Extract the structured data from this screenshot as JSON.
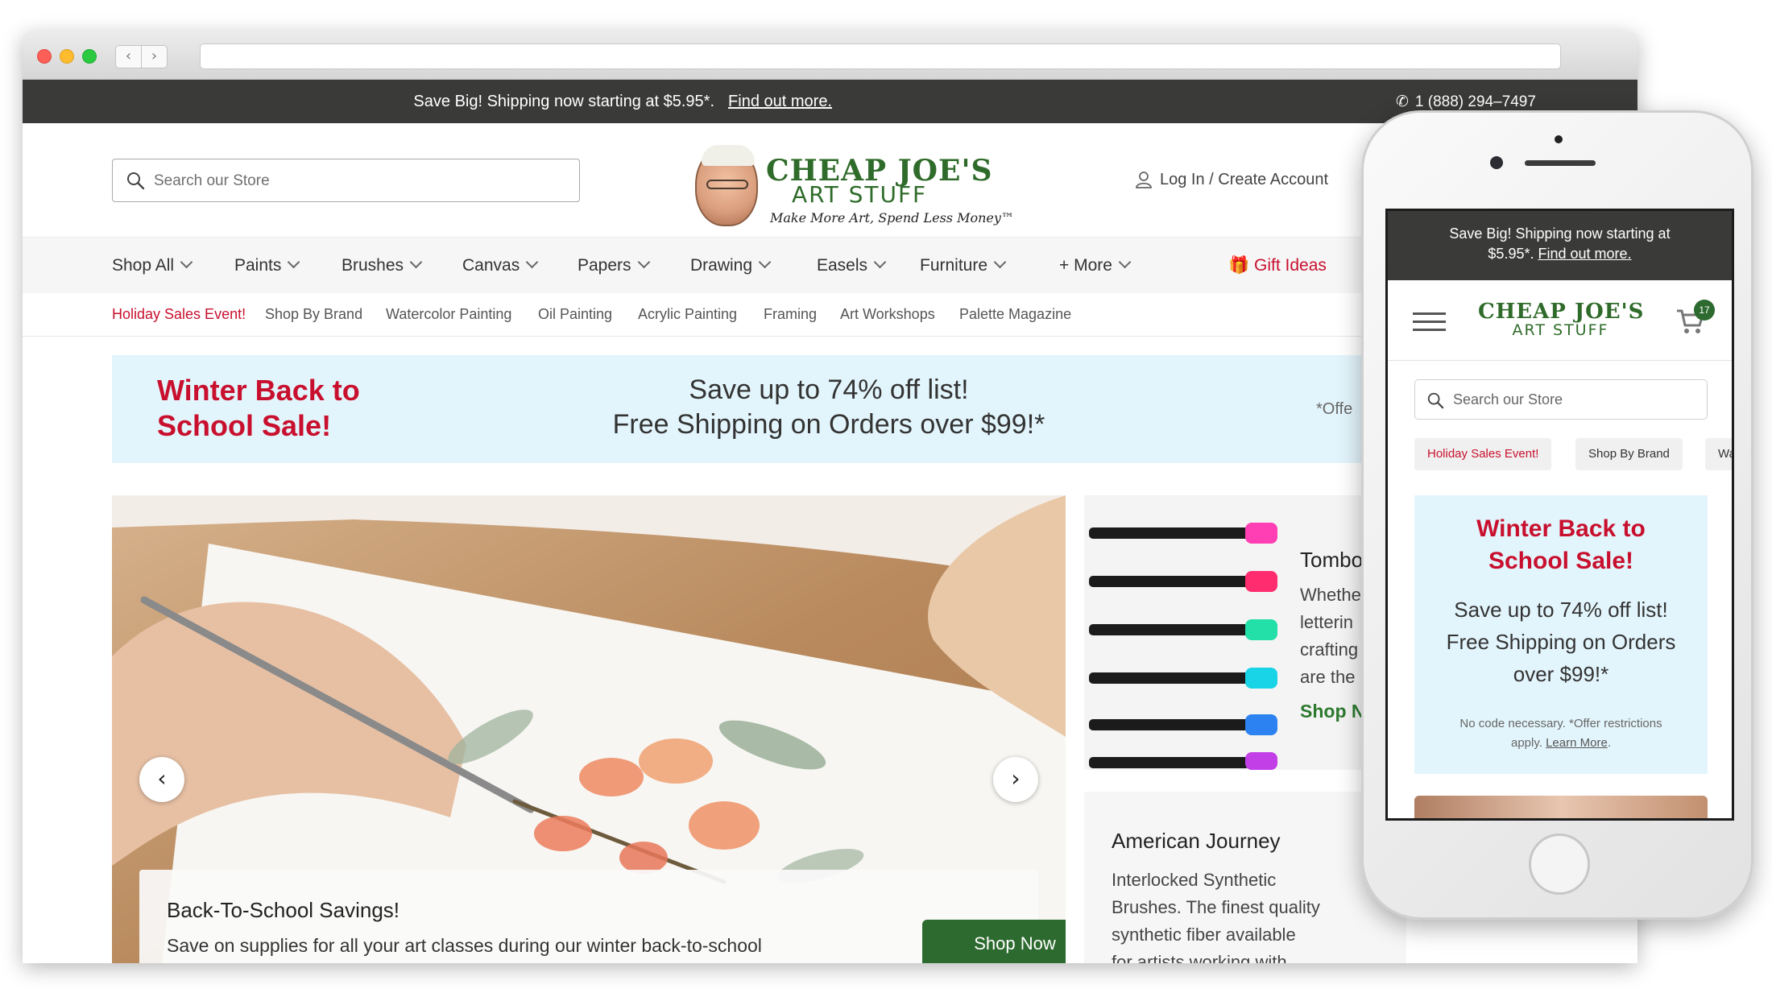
{
  "desktop": {
    "promo_bar": {
      "message": "Save Big! Shipping now starting at $5.95*.",
      "link": "Find out more.",
      "phone": "1 (888) 294–7497"
    },
    "search": {
      "placeholder": "Search our Store"
    },
    "logo": {
      "name": "CHEAP JOE'S",
      "sub": "ART STUFF",
      "tagline": "Make More Art, Spend Less Money™"
    },
    "account": {
      "label": "Log In / Create Account"
    },
    "main_nav": {
      "items": [
        {
          "label": "Shop All"
        },
        {
          "label": "Paints"
        },
        {
          "label": "Brushes"
        },
        {
          "label": "Canvas"
        },
        {
          "label": "Papers"
        },
        {
          "label": "Drawing"
        },
        {
          "label": "Easels"
        },
        {
          "label": "Furniture"
        },
        {
          "label": "+ More"
        }
      ],
      "gift_ideas": "Gift Ideas"
    },
    "sub_nav": {
      "items": [
        {
          "label": "Holiday Sales Event!"
        },
        {
          "label": "Shop By Brand"
        },
        {
          "label": "Watercolor Painting"
        },
        {
          "label": "Oil Painting"
        },
        {
          "label": "Acrylic Painting"
        },
        {
          "label": "Framing"
        },
        {
          "label": "Art Workshops"
        },
        {
          "label": "Palette Magazine"
        }
      ]
    },
    "sale_banner": {
      "title_line1": "Winter Back to",
      "title_line2": "School Sale!",
      "line1": "Save up to 74% off list!",
      "line2": "Free Shipping on Orders over $99!*",
      "fine": "*Offe"
    },
    "hero": {
      "card_title": "Back-To-School Savings!",
      "card_text": "Save on supplies for all your art classes during our winter back-to-school",
      "button": "Shop Now"
    },
    "tile_markers": {
      "title": "Tombo",
      "lines": [
        "Whethe",
        "letterin",
        "crafting",
        "are the"
      ],
      "cta": "Shop N"
    },
    "tile_brushes": {
      "title": "American Journey",
      "lines": [
        "Interlocked Synthetic",
        "Brushes. The finest quality",
        "synthetic fiber available",
        "for artists working with"
      ]
    }
  },
  "mobile": {
    "promo_line1": "Save Big! Shipping now starting at",
    "promo_price": "$5.95*.",
    "promo_link": "Find out more.",
    "logo_name": "CHEAP JOE'S",
    "logo_sub": "ART STUFF",
    "cart_count": "17",
    "search_placeholder": "Search our Store",
    "chips": [
      {
        "label": "Holiday Sales Event!"
      },
      {
        "label": "Shop By Brand"
      },
      {
        "label": "Wa"
      }
    ],
    "sale": {
      "title_line1": "Winter Back to",
      "title_line2": "School Sale!",
      "line1": "Save up to 74% off list!",
      "line2": "Free Shipping on Orders",
      "line3": "over $99!*",
      "fine_line1": "No code necessary. *Offer restrictions",
      "fine_line2": "apply.",
      "fine_link": "Learn More"
    }
  },
  "colors": {
    "promo_bar": "#3a3b39",
    "brand_green": "#2f6b2a",
    "sale_red": "#c8102e",
    "banner_blue": "#e3f5fc",
    "button_green": "#2d6a2f"
  },
  "icons": [
    "search-icon",
    "phone-icon",
    "user-icon",
    "chevron-down-icon",
    "gift-icon",
    "chevron-left-icon",
    "chevron-right-icon",
    "hamburger-icon",
    "cart-icon"
  ]
}
